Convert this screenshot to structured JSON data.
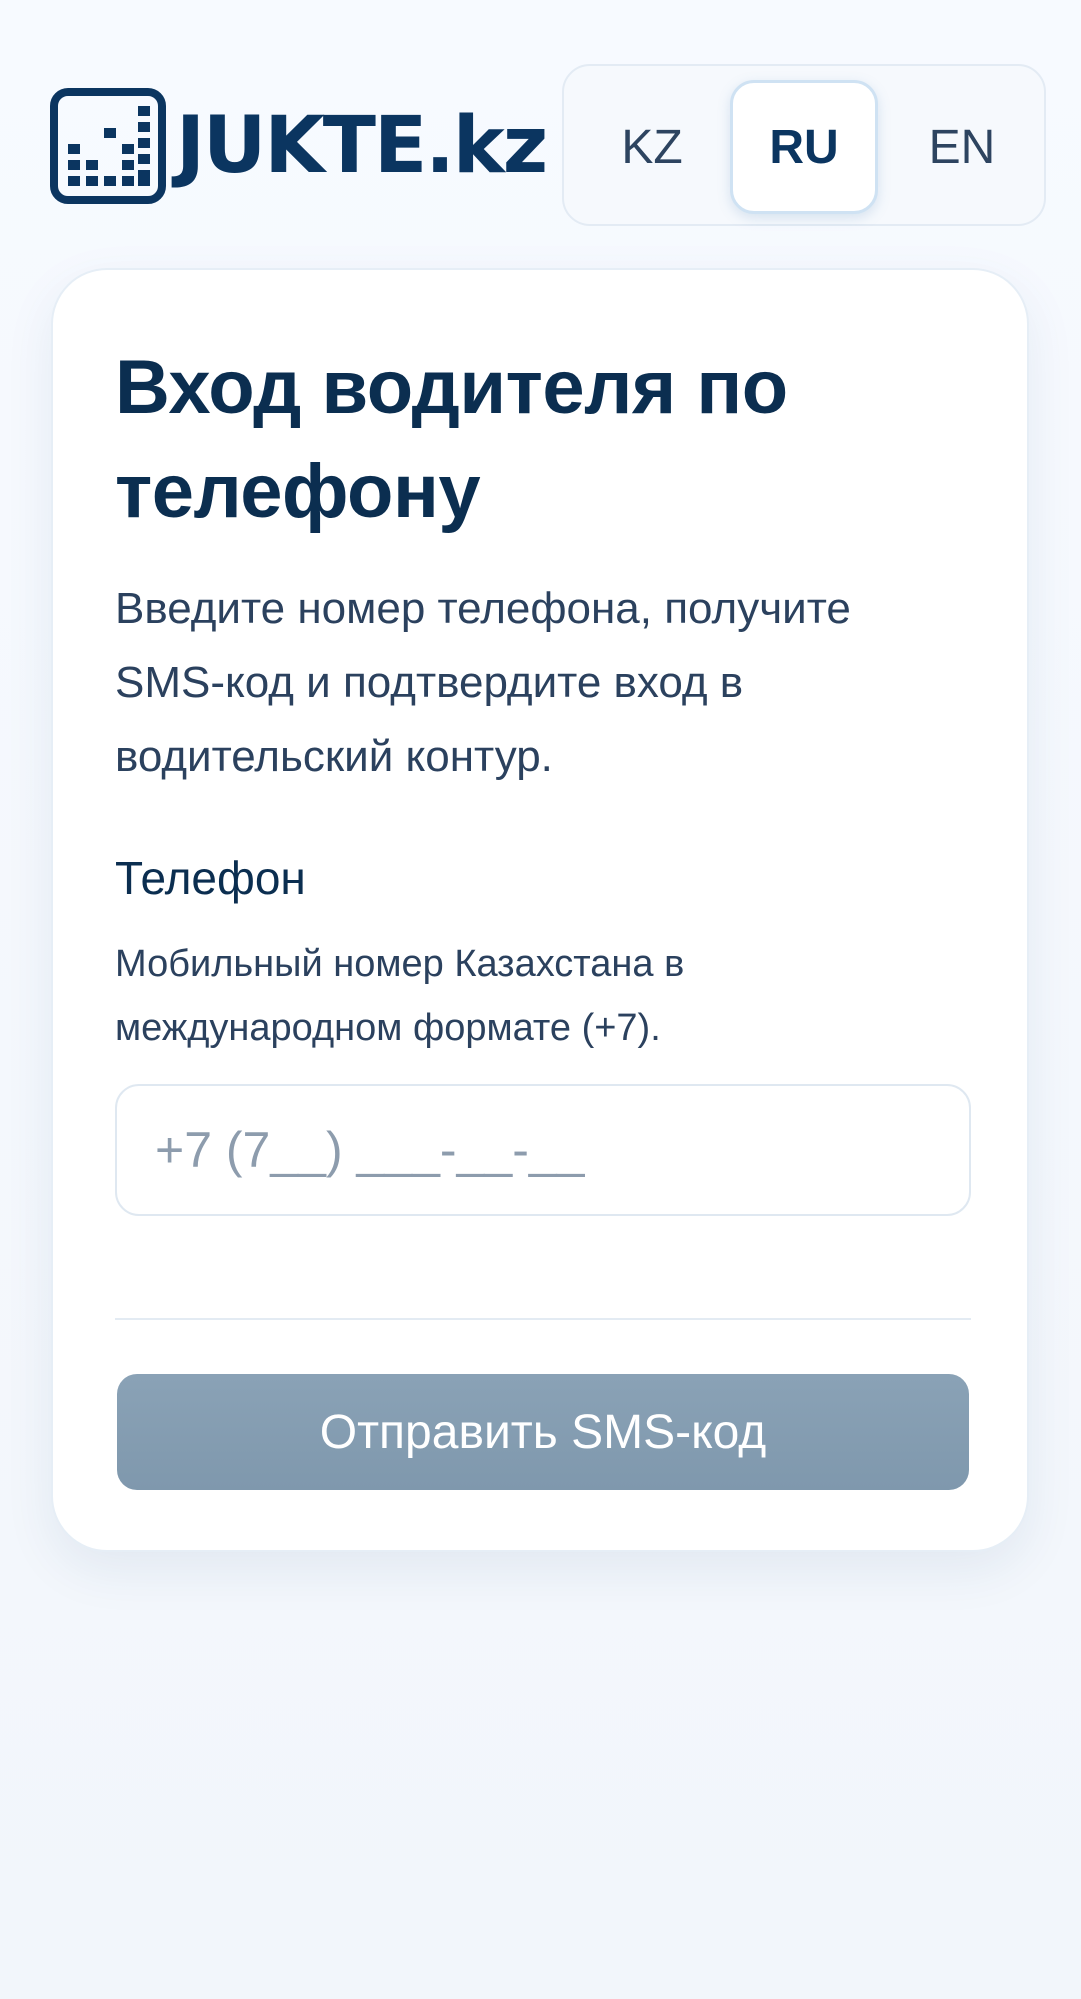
{
  "brand": {
    "name": "JUKTE.kz",
    "logo_icon": "jukte-logo-icon"
  },
  "languages": {
    "items": [
      "KZ",
      "RU",
      "EN"
    ],
    "selected": "RU"
  },
  "login": {
    "title": "Вход водителя по телефону",
    "subtitle": "Введите номер телефона, получите SMS-код и подтвердите вход в водительский контур.",
    "phone_label": "Телефон",
    "phone_hint": "Мобильный номер Казахстана в международном формате (+7).",
    "phone_value": "",
    "phone_placeholder": "+7 (7__) ___-__-__",
    "submit_label": "Отправить SMS-код"
  },
  "colors": {
    "brand": "#0b3560",
    "button_disabled": "#849db2",
    "page_bg": "#f4f8fc"
  }
}
